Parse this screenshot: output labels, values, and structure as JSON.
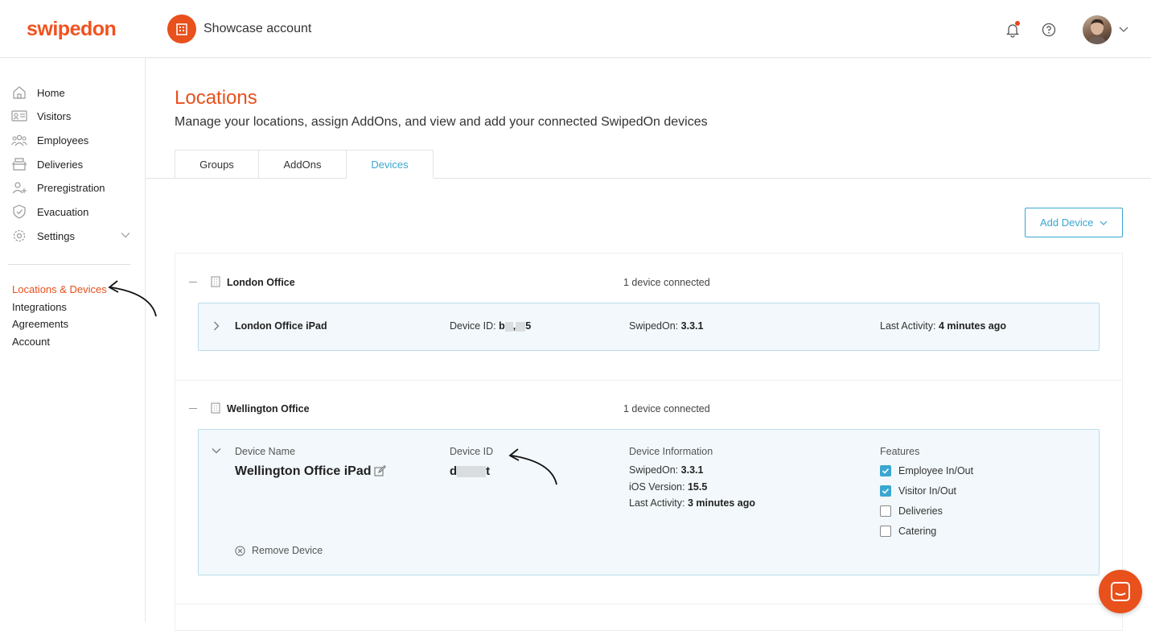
{
  "brand": {
    "logo_text": "swipedon",
    "accent": "#e8501c",
    "link": "#3aa7d0"
  },
  "header": {
    "account_name": "Showcase account"
  },
  "sidebar": {
    "items": [
      {
        "label": "Home",
        "icon": "home-icon"
      },
      {
        "label": "Visitors",
        "icon": "id-card-icon"
      },
      {
        "label": "Employees",
        "icon": "people-icon"
      },
      {
        "label": "Deliveries",
        "icon": "box-icon"
      },
      {
        "label": "Preregistration",
        "icon": "user-plus-icon"
      },
      {
        "label": "Evacuation",
        "icon": "shield-icon"
      },
      {
        "label": "Settings",
        "icon": "gear-icon"
      }
    ],
    "subitems": [
      {
        "label": "Locations & Devices",
        "active": true
      },
      {
        "label": "Integrations"
      },
      {
        "label": "Agreements"
      },
      {
        "label": "Account"
      }
    ]
  },
  "page": {
    "title": "Locations",
    "subtitle": "Manage your locations, assign AddOns, and view and add your connected SwipedOn devices",
    "tabs": [
      {
        "label": "Groups"
      },
      {
        "label": "AddOns"
      },
      {
        "label": "Devices",
        "active": true
      }
    ],
    "add_device_label": "Add Device"
  },
  "groups": [
    {
      "name": "London Office",
      "count_text": "1 device connected",
      "device": {
        "name": "London Office iPad",
        "id_label": "Device ID:",
        "id_start": "b",
        "id_mid": ",",
        "id_end": "5",
        "swipedon_label": "SwipedOn:",
        "swipedon_version": "3.3.1",
        "activity_label": "Last Activity:",
        "activity_value": "4 minutes ago"
      }
    },
    {
      "name": "Wellington Office",
      "count_text": "1 device connected",
      "device": {
        "name_label": "Device Name",
        "name": "Wellington Office iPad",
        "id_label": "Device ID",
        "id_start": "d",
        "id_end": "t",
        "info_label": "Device Information",
        "swipedon_label": "SwipedOn:",
        "swipedon_version": "3.3.1",
        "ios_label": "iOS Version:",
        "ios_version": "15.5",
        "activity_label": "Last Activity:",
        "activity_value": "3 minutes ago",
        "features_label": "Features",
        "features": [
          {
            "label": "Employee In/Out",
            "checked": true
          },
          {
            "label": "Visitor In/Out",
            "checked": true
          },
          {
            "label": "Deliveries",
            "checked": false
          },
          {
            "label": "Catering",
            "checked": false
          }
        ],
        "remove_label": "Remove Device"
      }
    }
  ]
}
